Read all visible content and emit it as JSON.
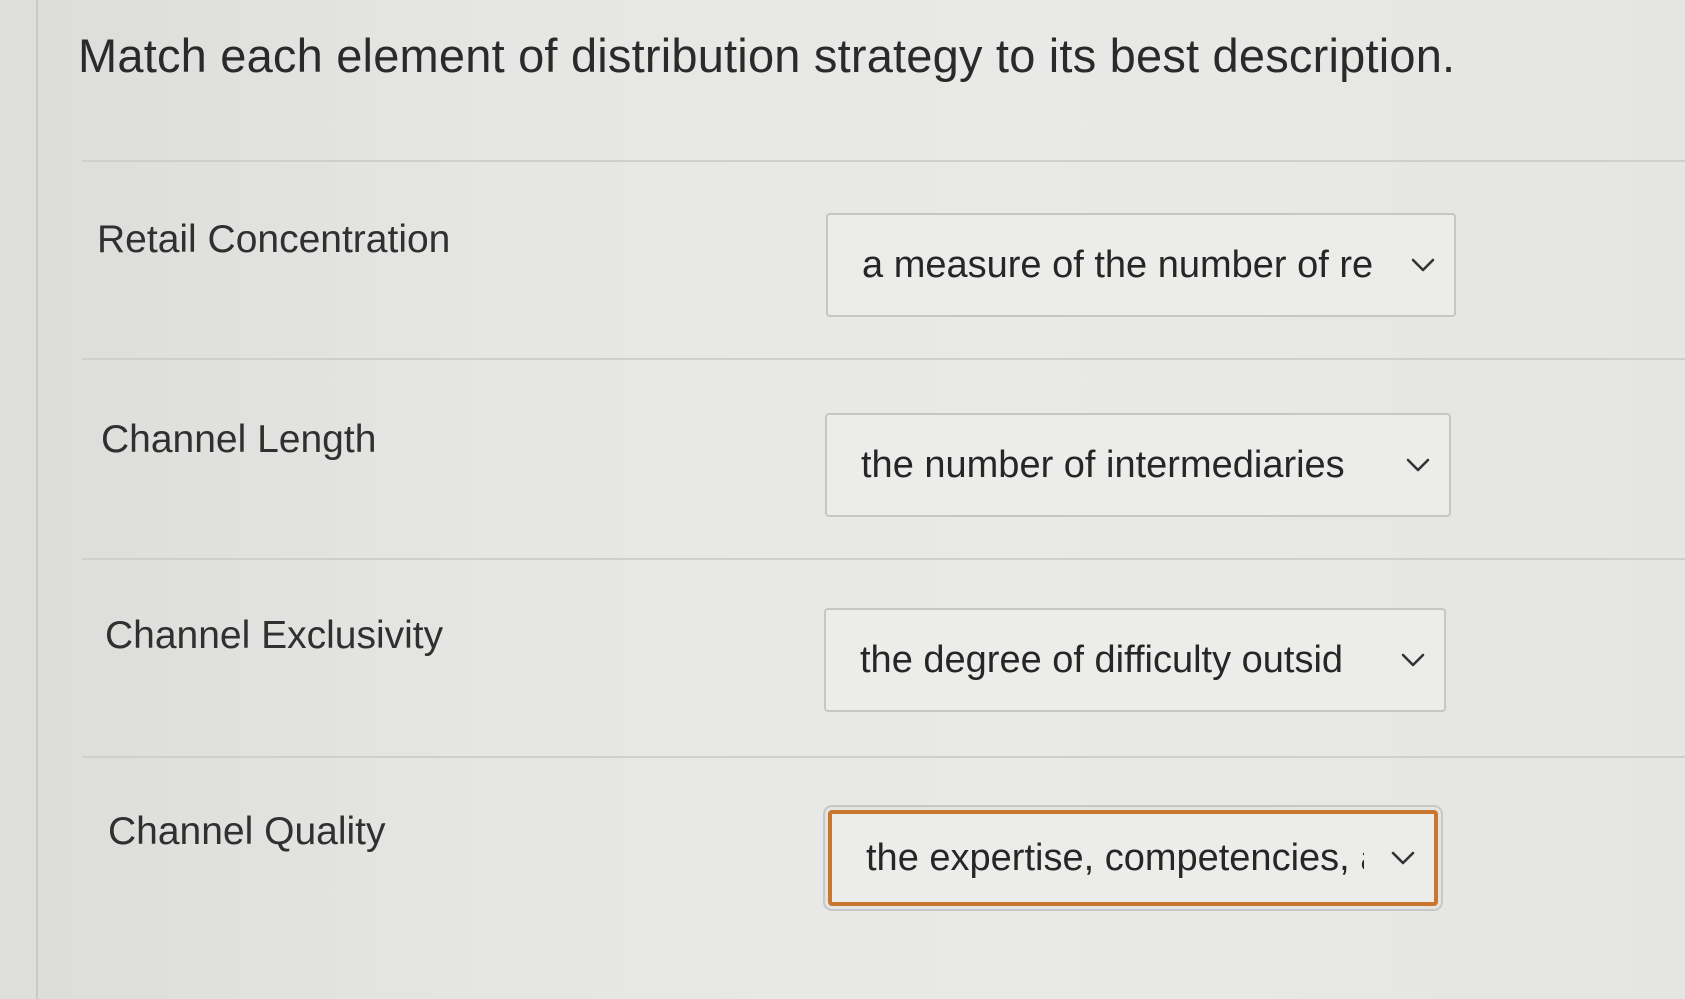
{
  "question": "Match each element of distribution strategy to its best description.",
  "rows": [
    {
      "label": "Retail Concentration",
      "selected": "a measure of the number of re"
    },
    {
      "label": "Channel Length",
      "selected": "the number of intermediaries"
    },
    {
      "label": "Channel Exclusivity",
      "selected": "the degree of difficulty outsid"
    },
    {
      "label": "Channel Quality",
      "selected": "the expertise, competencies, a"
    }
  ],
  "icons": {
    "dropdown": "chevron-down-icon"
  },
  "colors": {
    "focus_border": "#c9772e",
    "text": "#2c2c2c"
  }
}
